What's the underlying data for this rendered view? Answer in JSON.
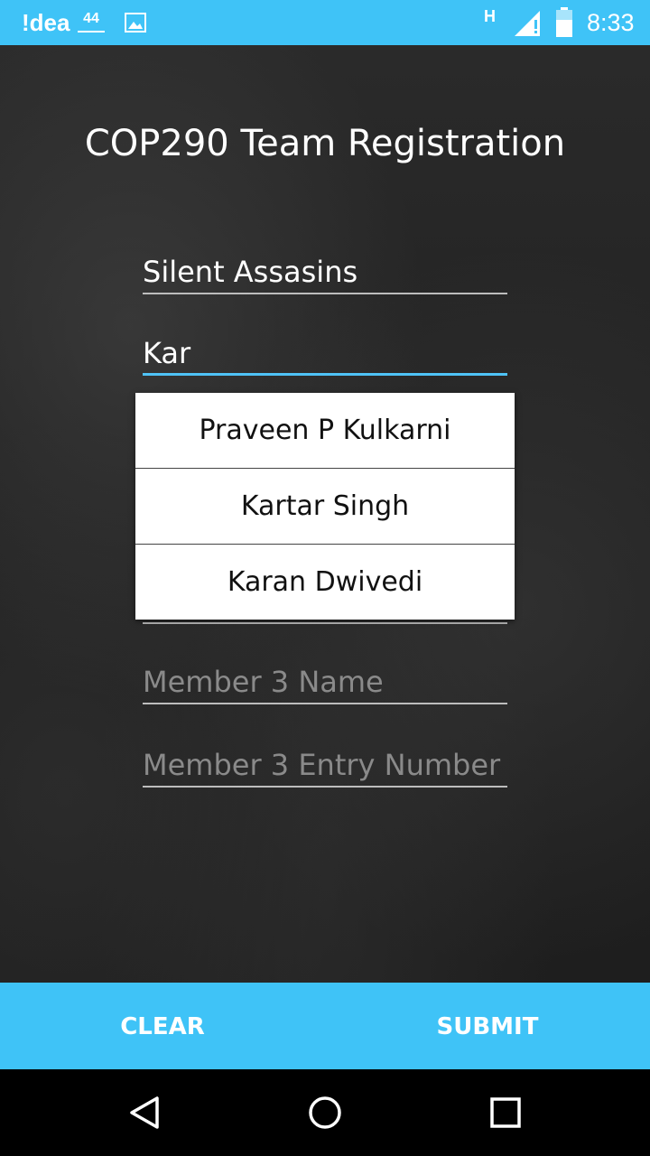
{
  "status_bar": {
    "carrier": "!dea",
    "network_badge": "44",
    "network_type": "H",
    "time": "8:33",
    "icons": [
      "image-icon",
      "signal-icon",
      "battery-icon"
    ]
  },
  "title": "COP290 Team Registration",
  "form": {
    "team_name_value": "Silent Assasins",
    "member2_value": "Kar",
    "member3_name_placeholder": "Member 3 Name",
    "member3_entry_placeholder": "Member 3 Entry Number"
  },
  "autocomplete": {
    "items": [
      "Praveen P Kulkarni",
      "Kartar Singh",
      "Karan Dwivedi"
    ]
  },
  "buttons": {
    "clear": "CLEAR",
    "submit": "SUBMIT"
  },
  "nav": {
    "icons": [
      "back-icon",
      "home-icon",
      "recents-icon"
    ]
  },
  "colors": {
    "accent": "#3fc3f7",
    "field_active": "#4fc3f7"
  }
}
